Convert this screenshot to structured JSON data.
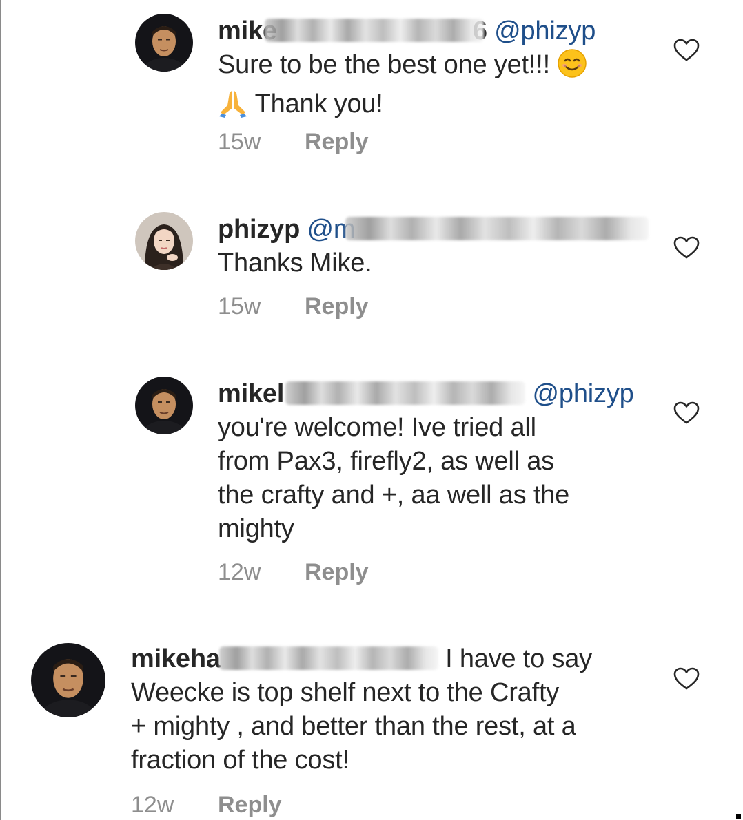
{
  "comments": [
    {
      "username": "mike",
      "username_suffix": "6",
      "mention": "@phizyp",
      "lines": [
        "Sure to be the best one yet!!!",
        "Thank you!"
      ],
      "emoji_1": "smiling-face-emoji",
      "emoji_2": "folded-hands-emoji",
      "time": "15w",
      "reply": "Reply"
    },
    {
      "username": "phizyp",
      "mention": "@m",
      "lines": [
        "Thanks Mike."
      ],
      "time": "15w",
      "reply": "Reply"
    },
    {
      "username": "mikel",
      "mention": "@phizyp",
      "lines": [
        "you're welcome! Ive tried all",
        "from Pax3, firefly2, as well as",
        "the crafty and +, aa well as the",
        "mighty"
      ],
      "time": "12w",
      "reply": "Reply"
    },
    {
      "username": "mikeha",
      "first_line_tail": "I have to say",
      "lines": [
        "Weecke is top shelf next to the Crafty",
        "+ mighty , and better than the rest, at a",
        "fraction of the cost!"
      ],
      "time": "12w",
      "reply": "Reply"
    }
  ],
  "icons": {
    "like": "heart-outline-icon"
  },
  "colors": {
    "text": "#262626",
    "mention": "#1f4f8a",
    "meta": "#8e8e8e"
  }
}
